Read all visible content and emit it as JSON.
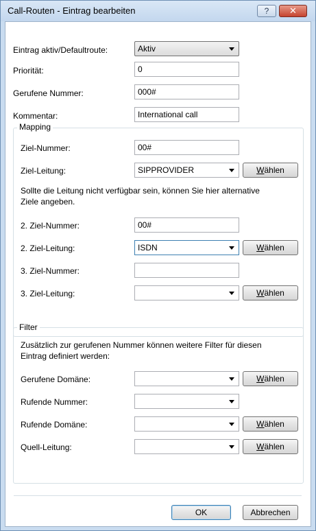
{
  "window": {
    "title": "Call-Routen - Eintrag bearbeiten",
    "help_label": "?",
    "close_label": "✕"
  },
  "form": {
    "active_label": "Eintrag aktiv/Defaultroute:",
    "active_value": "Aktiv",
    "priority_label": "Priorität:",
    "priority_value": "0",
    "called_number_label": "Gerufene Nummer:",
    "called_number_value": "000#",
    "comment_label": "Kommentar:",
    "comment_value": "International call"
  },
  "mapping": {
    "title": "Mapping",
    "target_number_label": "Ziel-Nummer:",
    "target_number_value": "00#",
    "target_line_label": "Ziel-Leitung:",
    "target_line_value": "SIPPROVIDER",
    "info_line1": "Sollte die Leitung nicht verfügbar sein, können Sie hier alternative",
    "info_line2": "Ziele angeben.",
    "target2_number_label": "2. Ziel-Nummer:",
    "target2_number_value": "00#",
    "target2_line_label": "2. Ziel-Leitung:",
    "target2_line_value": "ISDN",
    "target3_number_label": "3. Ziel-Nummer:",
    "target3_number_value": "",
    "target3_line_label": "3. Ziel-Leitung:",
    "target3_line_value": ""
  },
  "filter": {
    "title": "Filter",
    "info_line1": "Zusätzlich zur gerufenen Nummer können weitere Filter für diesen",
    "info_line2": "Eintrag definiert werden:",
    "called_domain_label": "Gerufene Domäne:",
    "calling_number_label": "Rufende Nummer:",
    "calling_domain_label": "Rufende Domäne:",
    "source_line_label": "Quell-Leitung:"
  },
  "choose_button": {
    "underlined": "W",
    "rest": "ählen"
  },
  "footer": {
    "ok_label": "OK",
    "cancel_label": "Abbrechen"
  }
}
